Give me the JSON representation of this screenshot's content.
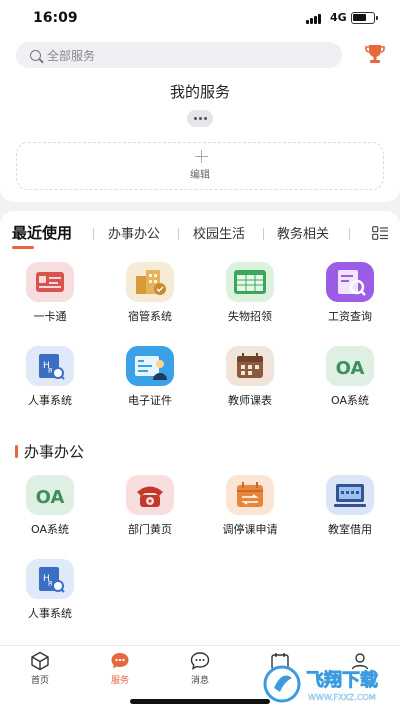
{
  "status_bar": {
    "time": "16:09",
    "network": "4G"
  },
  "search": {
    "placeholder": "全部服务"
  },
  "my_services": {
    "title": "我的服务",
    "edit_label": "编辑"
  },
  "tabs": [
    {
      "label": "最近使用",
      "active": true
    },
    {
      "label": "办事办公",
      "active": false
    },
    {
      "label": "校园生活",
      "active": false
    },
    {
      "label": "教务相关",
      "active": false
    }
  ],
  "recent_apps": [
    {
      "label": "一卡通",
      "icon": "id-card-icon"
    },
    {
      "label": "宿管系统",
      "icon": "dormitory-icon"
    },
    {
      "label": "失物招领",
      "icon": "lost-found-icon"
    },
    {
      "label": "工资查询",
      "icon": "salary-query-icon"
    },
    {
      "label": "人事系统",
      "icon": "hr-system-icon"
    },
    {
      "label": "电子证件",
      "icon": "e-certificate-icon"
    },
    {
      "label": "教师课表",
      "icon": "timetable-icon"
    },
    {
      "label": "OA系统",
      "icon": "oa-icon",
      "icon_text": "OA"
    }
  ],
  "section": {
    "title": "办事办公"
  },
  "office_apps": [
    {
      "label": "OA系统",
      "icon": "oa-icon",
      "icon_text": "OA"
    },
    {
      "label": "部门黄页",
      "icon": "phone-directory-icon"
    },
    {
      "label": "调停课申请",
      "icon": "class-adjust-icon"
    },
    {
      "label": "教室借用",
      "icon": "classroom-borrow-icon"
    },
    {
      "label": "人事系统",
      "icon": "hr-system-icon"
    }
  ],
  "bottom_nav": [
    {
      "label": "首页",
      "icon": "home-cube-icon",
      "active": false
    },
    {
      "label": "服务",
      "icon": "service-chat-icon",
      "active": true
    },
    {
      "label": "消息",
      "icon": "message-icon",
      "active": false
    },
    {
      "label": "",
      "icon": "calendar-icon",
      "active": false
    },
    {
      "label": "",
      "icon": "profile-icon",
      "active": false
    }
  ],
  "watermark": {
    "text": "飞翔下载",
    "url_text": "WWW.FXXZ.COM"
  },
  "colors": {
    "accent": "#e8663d",
    "background": "#f2f2f4"
  }
}
